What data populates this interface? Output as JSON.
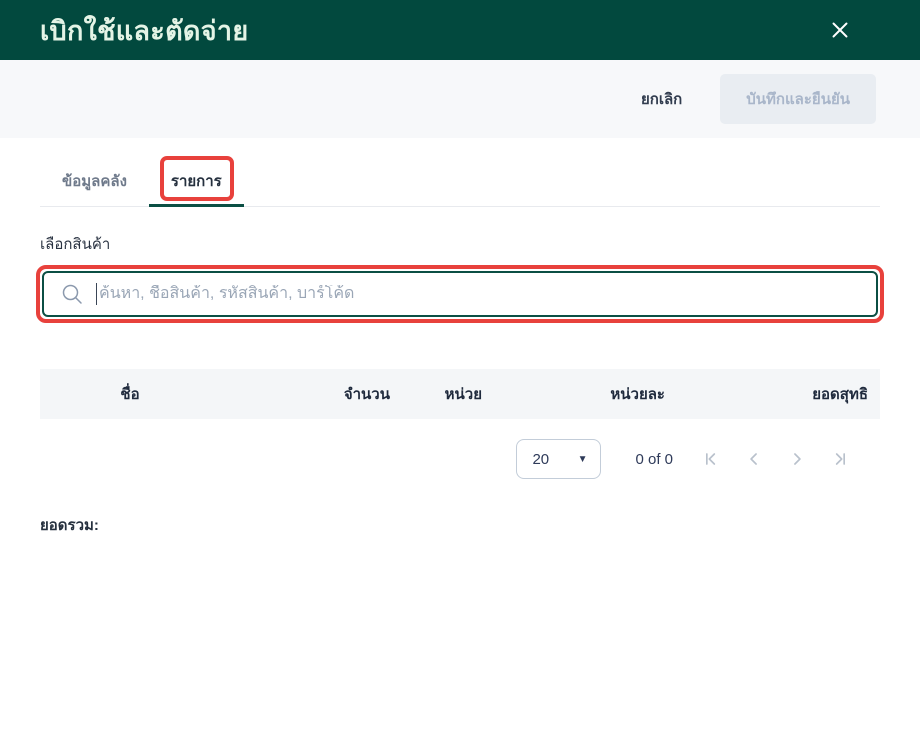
{
  "modal": {
    "title": "เบิกใช้และตัดจ่าย"
  },
  "toolbar": {
    "cancel_label": "ยกเลิก",
    "save_label": "บันทึกและยืนยัน"
  },
  "tabs": {
    "warehouse_label": "ข้อมูลคลัง",
    "items_label": "รายการ",
    "active_tab": "รายการ"
  },
  "product_picker": {
    "label": "เลือกสินค้า",
    "search_value": "",
    "search_placeholder": "ค้นหา, ชื่อสินค้า, รหัสสินค้า, บาร์โค้ด"
  },
  "table": {
    "columns": {
      "name": "ชื่อ",
      "quantity": "จำนวน",
      "unit": "หน่วย",
      "price_per_unit": "หน่วยละ",
      "net_total": "ยอดสุทธิ"
    },
    "rows": []
  },
  "pagination": {
    "page_size": "20",
    "range_label": "0 of 0",
    "icons": [
      "first-page-icon",
      "previous-page-icon",
      "next-page-icon",
      "last-page-icon"
    ]
  },
  "summary": {
    "total_label": "ยอดรวม:"
  },
  "colors": {
    "header_bg": "#02493e",
    "header_text": "#e4f4e6",
    "toolbar_bg": "#f7f8fa",
    "accent_green": "#0b4f44",
    "annotation_red": "#e8413c",
    "disabled_button_bg": "#e9edf2",
    "disabled_button_text": "#a9b6ca",
    "table_head_bg": "#f4f6f8",
    "muted_icon": "#b9c1cc"
  }
}
